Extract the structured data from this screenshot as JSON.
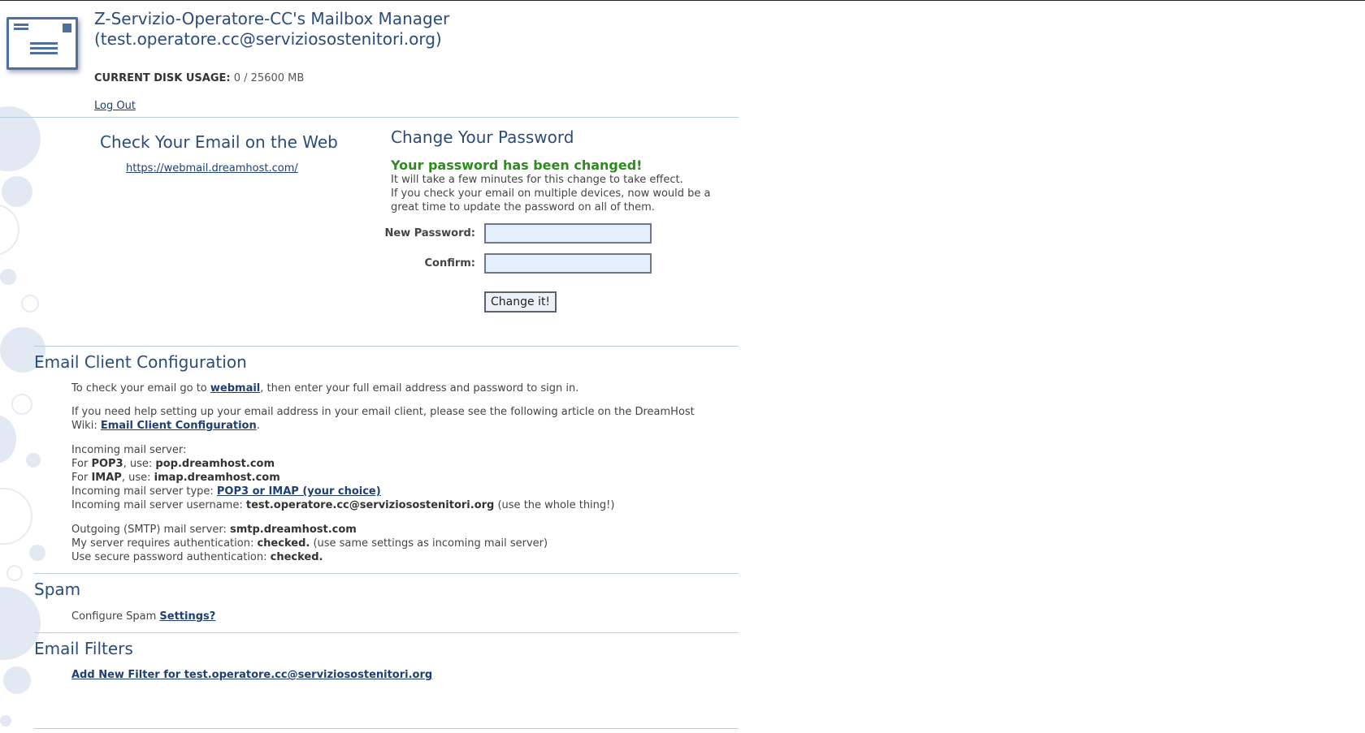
{
  "header": {
    "title_line1": "Z-Servizio-Operatore-CC's Mailbox Manager",
    "title_line2": "(test.operatore.cc@serviziosostenitori.org)",
    "disk_label": "CURRENT DISK USAGE:",
    "disk_value": "0 / 25600 MB",
    "logout": "Log Out"
  },
  "webmail": {
    "heading": "Check Your Email on the Web",
    "url": "https://webmail.dreamhost.com/"
  },
  "password": {
    "heading": "Change Your Password",
    "success": "Your password has been changed!",
    "msg_line1": "It will take a few minutes for this change to take effect.",
    "msg_line2": "If you check your email on multiple devices, now would be a great time to update the password on all of them.",
    "new_label": "New Password:",
    "confirm_label": "Confirm:",
    "button": "Change it!"
  },
  "client_config": {
    "heading": "Email Client Configuration",
    "p1_pre": "To check your email go to ",
    "p1_link": "webmail",
    "p1_post": ", then enter your full email address and password to sign in.",
    "p2_pre": "If you need help setting up your email address in your email client, please see the following article on the DreamHost Wiki: ",
    "p2_link": "Email Client Configuration",
    "p2_post": ".",
    "incoming_label": "Incoming mail server:",
    "pop3_pre": "For ",
    "pop3_proto": "POP3",
    "pop3_mid": ", use: ",
    "pop3_server": "pop.dreamhost.com",
    "imap_pre": "For ",
    "imap_proto": "IMAP",
    "imap_mid": ", use: ",
    "imap_server": "imap.dreamhost.com",
    "type_label": "Incoming mail server type: ",
    "type_link": "POP3 or IMAP (your choice)",
    "username_label": "Incoming mail server username: ",
    "username_value": "test.operatore.cc@serviziosostenitori.org",
    "username_note": " (use the whole thing!)",
    "smtp_label": "Outgoing (SMTP) mail server: ",
    "smtp_value": "smtp.dreamhost.com",
    "auth_label": "My server requires authentication: ",
    "auth_value": "checked.",
    "auth_note": " (use same settings as incoming mail server)",
    "secure_label": "Use secure password authentication: ",
    "secure_value": "checked."
  },
  "spam": {
    "heading": "Spam",
    "text": "Configure Spam ",
    "link": "Settings?"
  },
  "filters": {
    "heading": "Email Filters",
    "link": "Add New Filter for test.operatore.cc@serviziosostenitori.org"
  }
}
